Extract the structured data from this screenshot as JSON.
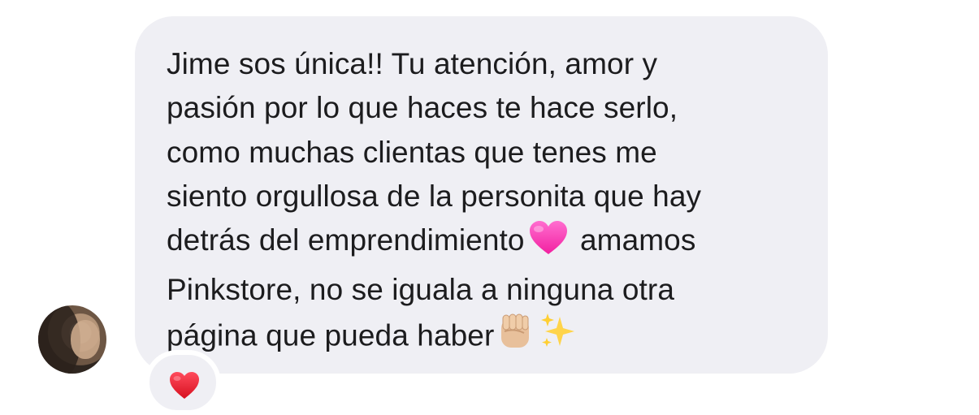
{
  "avatar": {
    "name": "avatar-sender"
  },
  "message": {
    "line1": "Jime sos única!! Tu atención, amor y",
    "line2": "pasión por lo que haces te hace serlo,",
    "line3": "como muchas clientas que tenes me",
    "line4": "siento orgullosa de la personita que hay",
    "line5a": "detrás del emprendimiento",
    "line5b": "amamos",
    "line6": "Pinkstore, no se iguala a ninguna otra",
    "line7": "página que pueda haber"
  },
  "icons": {
    "inline_heart": "pink-heart-icon",
    "fist": "raised-fist-icon",
    "sparkles": "sparkles-icon",
    "reaction": "red-heart-icon"
  },
  "colors": {
    "bubble": "#efeff4",
    "text": "#1c1c1e",
    "pink_heart": "#ff3fb0",
    "red_heart": "#e0142b"
  }
}
